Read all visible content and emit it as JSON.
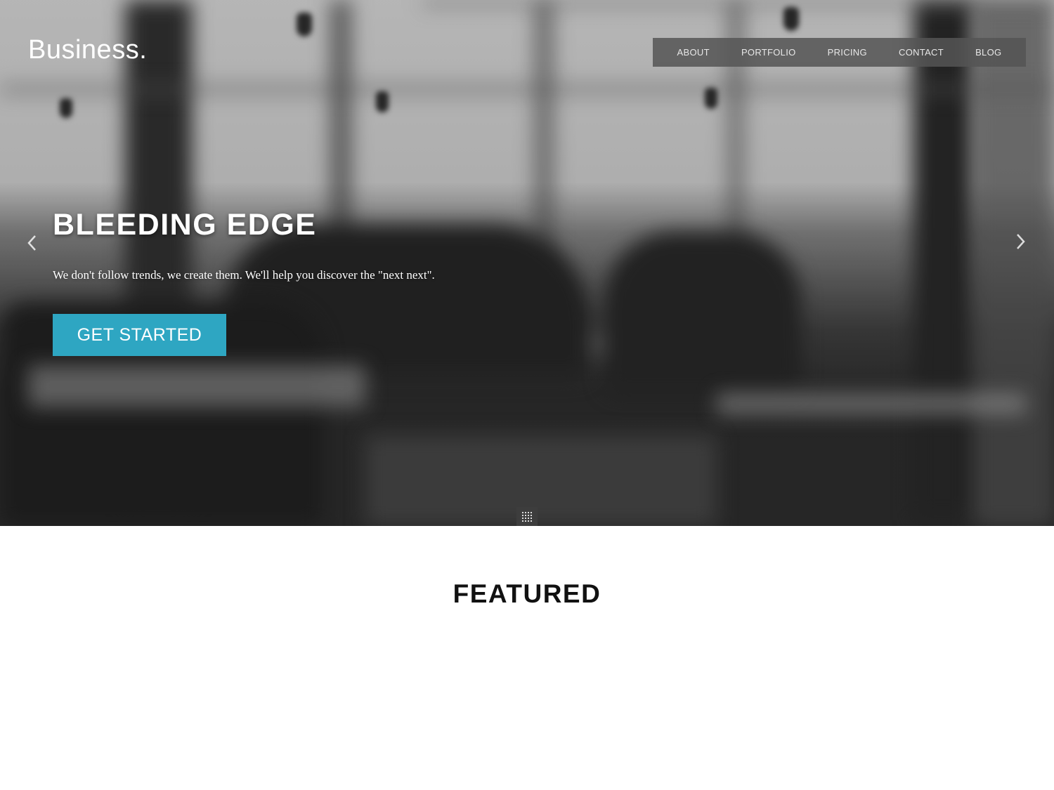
{
  "brand": {
    "logo_text": "Business."
  },
  "nav": {
    "items": [
      {
        "label": "ABOUT"
      },
      {
        "label": "PORTFOLIO"
      },
      {
        "label": "PRICING"
      },
      {
        "label": "CONTACT"
      },
      {
        "label": "BLOG"
      }
    ]
  },
  "hero": {
    "title": "BLEEDING EDGE",
    "subtitle": "We don't follow trends, we create them. We'll help you discover the \"next next\".",
    "cta_label": "GET STARTED",
    "prev_icon": "chevron-left-icon",
    "next_icon": "chevron-right-icon",
    "grid_icon": "grid-icon"
  },
  "featured": {
    "title": "FEATURED"
  },
  "colors": {
    "accent": "#2ea6c2",
    "nav_bg": "#555555",
    "heading": "#111111"
  }
}
